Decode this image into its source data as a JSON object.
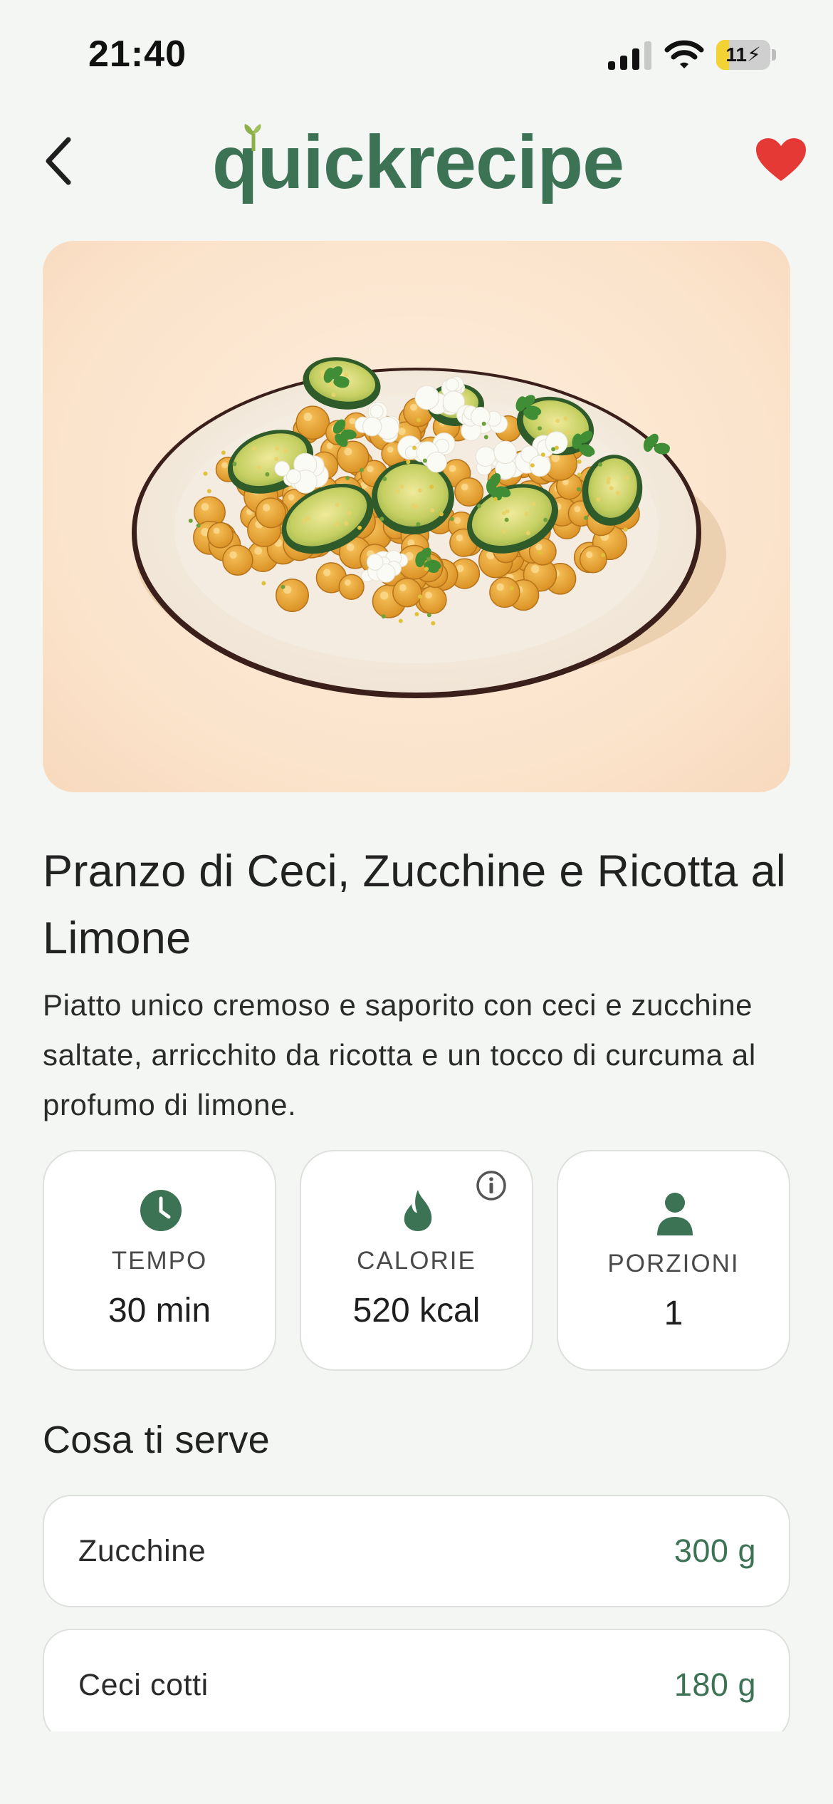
{
  "status_bar": {
    "time": "21:40",
    "battery_text": "11",
    "battery_level": 0.11,
    "icons": [
      "signal-icon",
      "wifi-icon",
      "battery-icon"
    ]
  },
  "header": {
    "logo_text": "quickrecipe",
    "back_icon": "chevron-left-icon",
    "favorite_icon": "heart-icon",
    "brand_color": "#3d7355",
    "favorite_color": "#e53935"
  },
  "recipe": {
    "title": "Pranzo di Ceci, Zucchine e Ricotta al Limone",
    "description": "Piatto unico cremoso e saporito con ceci e zucchine saltate, arricchito da ricotta e un tocco di curcuma al profumo di limone.",
    "image_alt": "Piatto con ceci, zucchine saltate e ricotta"
  },
  "stats": [
    {
      "icon": "clock-icon",
      "label": "TEMPO",
      "value": "30 min"
    },
    {
      "icon": "flame-icon",
      "label": "CALORIE",
      "value": "520 kcal",
      "info_icon": "info-icon"
    },
    {
      "icon": "person-icon",
      "label": "PORZIONI",
      "value": "1"
    }
  ],
  "ingredients": {
    "title": "Cosa ti serve",
    "items": [
      {
        "name": "Zucchine",
        "qty": "300 g"
      },
      {
        "name": "Ceci cotti",
        "qty": "180 g"
      }
    ]
  }
}
